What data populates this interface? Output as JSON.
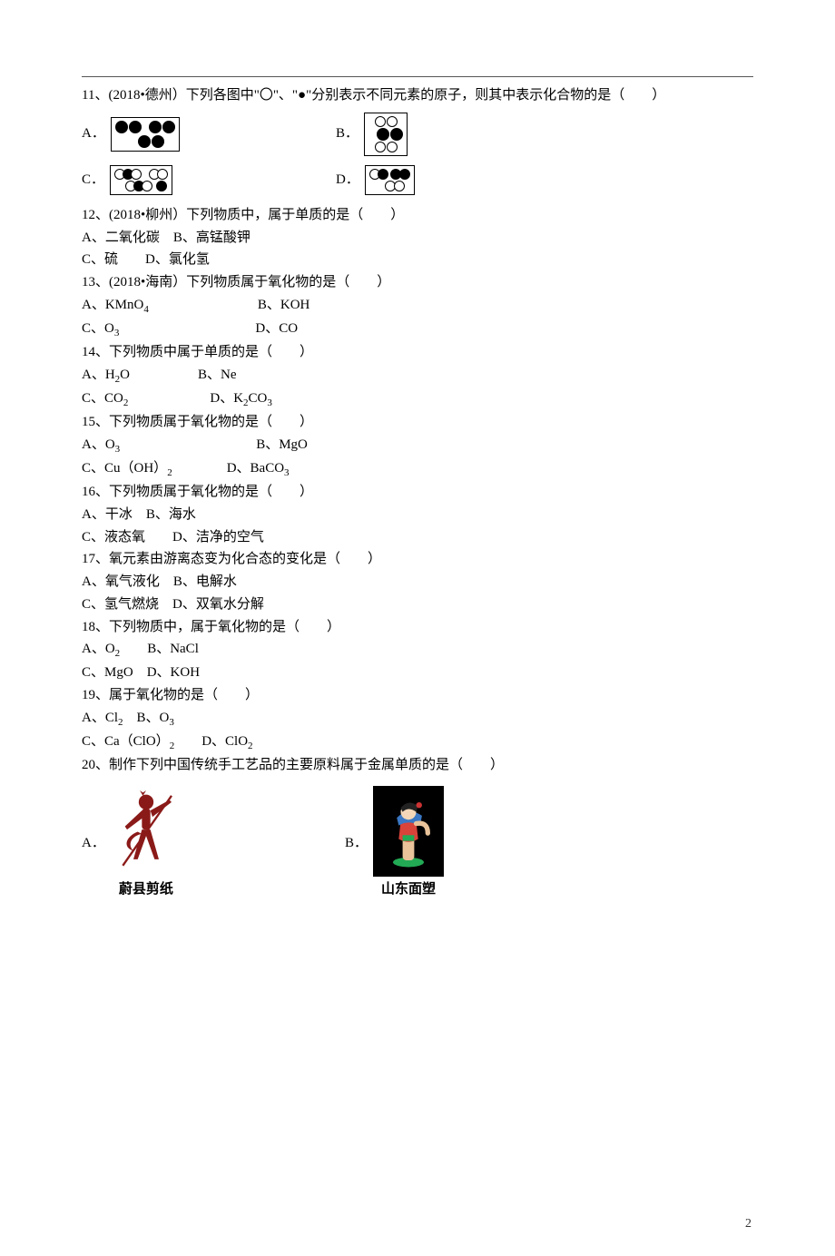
{
  "page_number": "2",
  "q11": {
    "text": "11、(2018•德州）下列各图中\"〇\"、\"●\"分别表示不同元素的原子，则其中表示化合物的是（　　）",
    "labels": {
      "A": "A．",
      "B": "B．",
      "C": "C．",
      "D": "D．"
    }
  },
  "q12": {
    "text": "12、(2018•柳州）下列物质中，属于单质的是（　　）",
    "A": "A、二氧化碳",
    "B": "B、高锰酸钾",
    "C": "C、硫",
    "D": "D、氯化氢"
  },
  "q13": {
    "text": "13、(2018•海南）下列物质属于氧化物的是（　　）",
    "A": "A、KMnO",
    "A_sub": "4",
    "B": "B、KOH",
    "C": "C、O",
    "C_sub": "3",
    "D": "D、CO"
  },
  "q14": {
    "text": "14、下列物质中属于单质的是（　　）",
    "A": "A、H",
    "A_sub": "2",
    "A_tail": "O",
    "B": "B、Ne",
    "C": "C、CO",
    "C_sub": "2",
    "D": "D、K",
    "D_sub1": "2",
    "D_mid": "CO",
    "D_sub2": "3"
  },
  "q15": {
    "text": "15、下列物质属于氧化物的是（　　）",
    "A": "A、O",
    "A_sub": "3",
    "B": "B、MgO",
    "C": "C、Cu（OH）",
    "C_sub": "2",
    "D": "D、BaCO",
    "D_sub": "3"
  },
  "q16": {
    "text": "16、下列物质属于氧化物的是（　　）",
    "A": "A、干冰",
    "B": "B、海水",
    "C": "C、液态氧",
    "D": "D、洁净的空气"
  },
  "q17": {
    "text": "17、氧元素由游离态变为化合态的变化是（　　）",
    "A": "A、氧气液化",
    "B": "B、电解水",
    "C": "C、氢气燃烧",
    "D": "D、双氧水分解"
  },
  "q18": {
    "text": "18、下列物质中，属于氧化物的是（　　）",
    "A": "A、O",
    "A_sub": "2",
    "B": "B、NaCl",
    "C": "C、MgO",
    "D": "D、KOH"
  },
  "q19": {
    "text": "19、属于氧化物的是（　　）",
    "A": "A、Cl",
    "A_sub": "2",
    "B": "B、O",
    "B_sub": "3",
    "C": "C、Ca（ClO）",
    "C_sub": "2",
    "D": "D、ClO",
    "D_sub": "2"
  },
  "q20": {
    "text": "20、制作下列中国传统手工艺品的主要原料属于金属单质的是（　　）",
    "labels": {
      "A": "A．",
      "B": "B．"
    },
    "captions": {
      "A": "蔚县剪纸",
      "B": "山东面塑"
    }
  }
}
